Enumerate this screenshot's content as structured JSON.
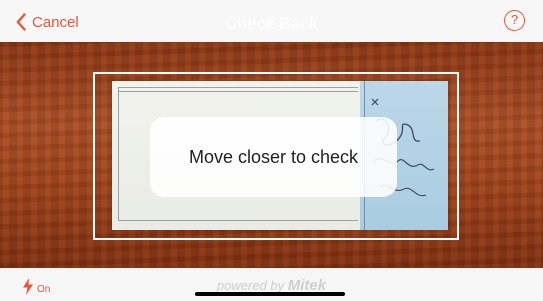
{
  "header": {
    "cancel_label": "Cancel",
    "title": "Check Back",
    "help_label": "?"
  },
  "camera": {
    "message": "Move closer to check"
  },
  "footer": {
    "flash_label": "On",
    "powered_prefix": "powered by",
    "powered_brand": "Mitek"
  },
  "colors": {
    "accent": "#e8563a",
    "title": "#ffffff"
  },
  "icons": {
    "cancel": "chevron-left-icon",
    "help": "question-circle-icon",
    "flash": "lightning-bolt-icon"
  }
}
